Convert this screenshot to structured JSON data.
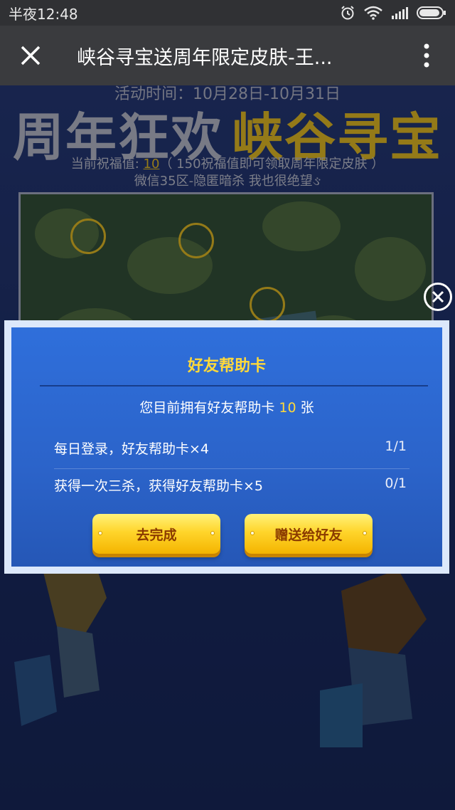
{
  "status_bar": {
    "time": "半夜12:48",
    "icons": [
      "alarm-icon",
      "wifi-icon",
      "signal-icon",
      "battery-icon"
    ]
  },
  "title_bar": {
    "close_icon": "close-icon",
    "title": "峡谷寻宝送周年限定皮肤-王...",
    "more_icon": "more-vertical-icon"
  },
  "page": {
    "activity_time": "活动时间：10月28日-10月31日",
    "headline_part1": "周年狂欢",
    "headline_part2": "峡谷寻宝",
    "blessing_prefix": "当前祝福值: ",
    "blessing_value": "10",
    "blessing_suffix": "（ 150祝福值即可领取周年限定皮肤 ）",
    "server_line": "微信35区-隐匿暗杀 我也很绝望ઙ"
  },
  "modal": {
    "title": "好友帮助卡",
    "summary_prefix": "您目前拥有好友帮助卡 ",
    "summary_count": "10",
    "summary_suffix": " 张",
    "tasks": [
      {
        "label": "每日登录，好友帮助卡×4",
        "progress": "1/1"
      },
      {
        "label": "获得一次三杀，获得好友帮助卡×5",
        "progress": "0/1"
      }
    ],
    "complete_button": "去完成",
    "gift_button": "赠送给好友"
  },
  "colors": {
    "accent_yellow": "#ffd93a",
    "modal_blue": "#2f6fdb",
    "button_text": "#8a3a00"
  }
}
